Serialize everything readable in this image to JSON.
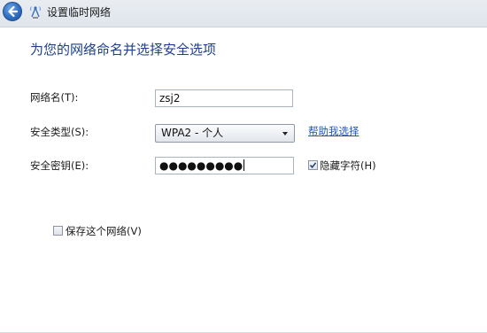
{
  "window": {
    "title": "设置临时网络"
  },
  "page": {
    "heading": "为您的网络命名并选择安全选项"
  },
  "form": {
    "network_name": {
      "label": "网络名(T):",
      "value": "zsj2"
    },
    "security_type": {
      "label": "安全类型(S):",
      "selected": "WPA2 - 个人",
      "help_link": "帮助我选择"
    },
    "security_key": {
      "label": "安全密钥(E):",
      "value": "●●●●●●●●●",
      "hide_chars_label": "隐藏字符(H)",
      "hide_chars_checked": true
    },
    "save_network": {
      "label": "保存这个网络(V)",
      "checked": false
    }
  },
  "icons": {
    "back": "back-arrow-icon",
    "network": "wireless-network-icon"
  },
  "colors": {
    "heading": "#1e3f8c",
    "link": "#1d56b8"
  }
}
